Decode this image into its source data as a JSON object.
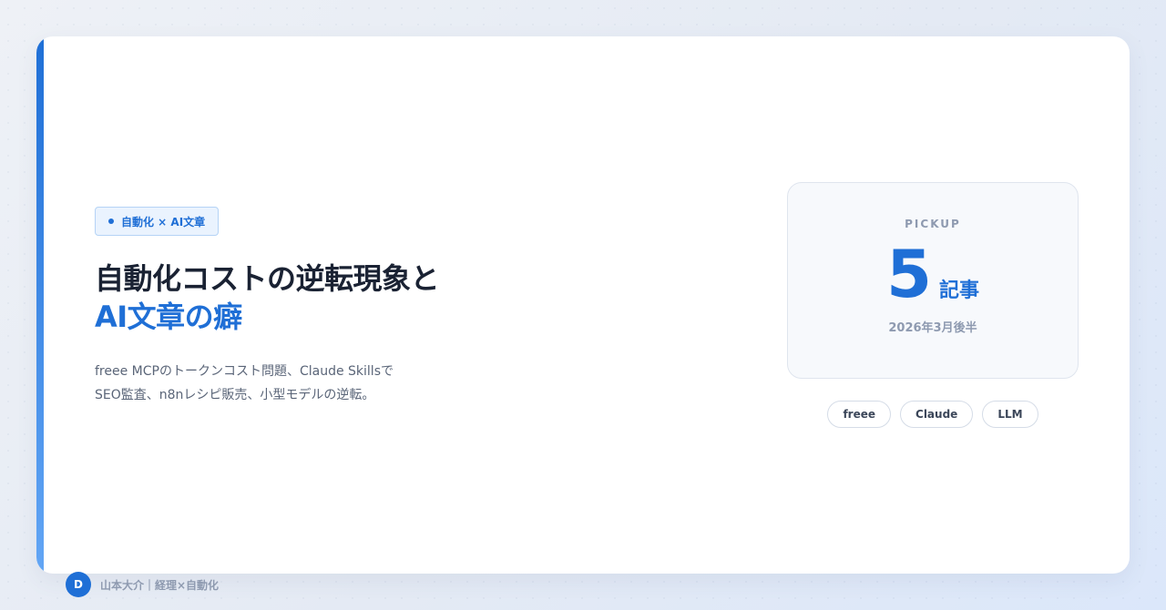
{
  "category_tag": "自動化 × AI文章",
  "title": {
    "line1": "自動化コストの逆転現象と",
    "line2": "AI文章の癖"
  },
  "description": {
    "line1": "freee MCPのトークンコスト問題、Claude Skillsで",
    "line2": "SEO監査、n8nレシピ販売、小型モデルの逆転。"
  },
  "pickup": {
    "label": "PICKUP",
    "count": "5",
    "unit": "記事",
    "period": "2026年3月後半"
  },
  "tags": [
    "freee",
    "Claude",
    "LLM"
  ],
  "author": {
    "initial": "D",
    "byline": "山本大介｜経理×自動化"
  },
  "colors": {
    "accent": "#1f6fd6",
    "text_dark": "#1a2233",
    "text_muted": "#8e9ab0"
  }
}
